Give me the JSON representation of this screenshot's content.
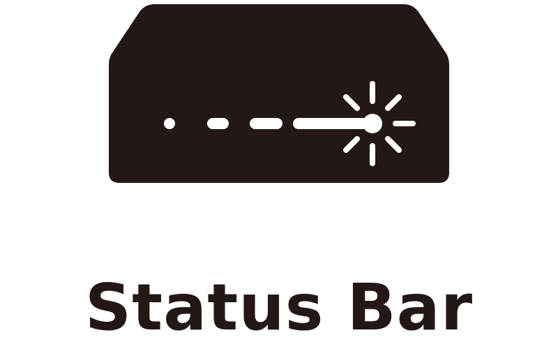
{
  "icon": {
    "name": "status-bar-icon",
    "fill_color": "#231816",
    "accent_color": "#ffffff"
  },
  "caption": {
    "text": "Status Bar",
    "color": "#231816"
  }
}
